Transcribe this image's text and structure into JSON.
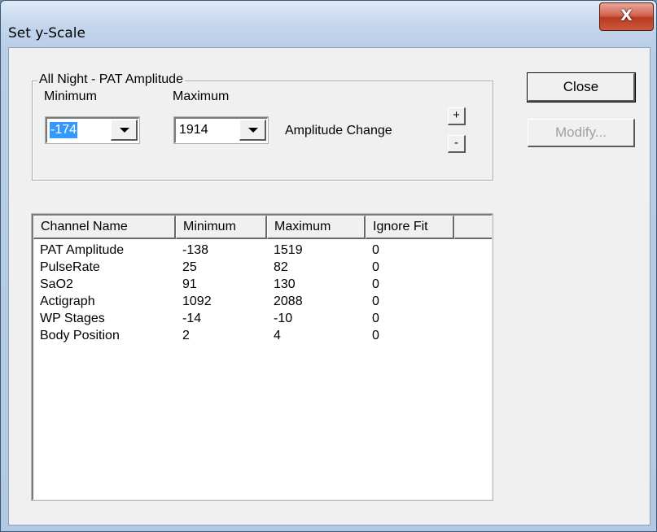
{
  "window": {
    "title": "Set y-Scale",
    "close_glyph": "X"
  },
  "group": {
    "title": "All Night - PAT Amplitude",
    "minimum_label": "Minimum",
    "maximum_label": "Maximum",
    "minimum_value": "-174",
    "maximum_value": "1914",
    "amplitude_change_label": "Amplitude Change",
    "plus_label": "+",
    "minus_label": "-"
  },
  "buttons": {
    "close_label": "Close",
    "modify_label": "Modify..."
  },
  "table": {
    "columns": [
      "Channel Name",
      "Minimum",
      "Maximum",
      "Ignore Fit"
    ],
    "rows": [
      [
        "PAT Amplitude",
        "-138",
        "1519",
        "0"
      ],
      [
        "PulseRate",
        "25",
        "82",
        "0"
      ],
      [
        "SaO2",
        "91",
        "130",
        "0"
      ],
      [
        "Actigraph",
        "1092",
        "2088",
        "0"
      ],
      [
        "WP Stages",
        "-14",
        "-10",
        "0"
      ],
      [
        "Body Position",
        "2",
        "4",
        "0"
      ]
    ]
  },
  "icons": {
    "dropdown": "chevron-down-icon",
    "window_close": "close-icon"
  },
  "colors": {
    "selection": "#3399ff",
    "close_button": "#c94a32",
    "dialog_face": "#f0f0f0"
  }
}
